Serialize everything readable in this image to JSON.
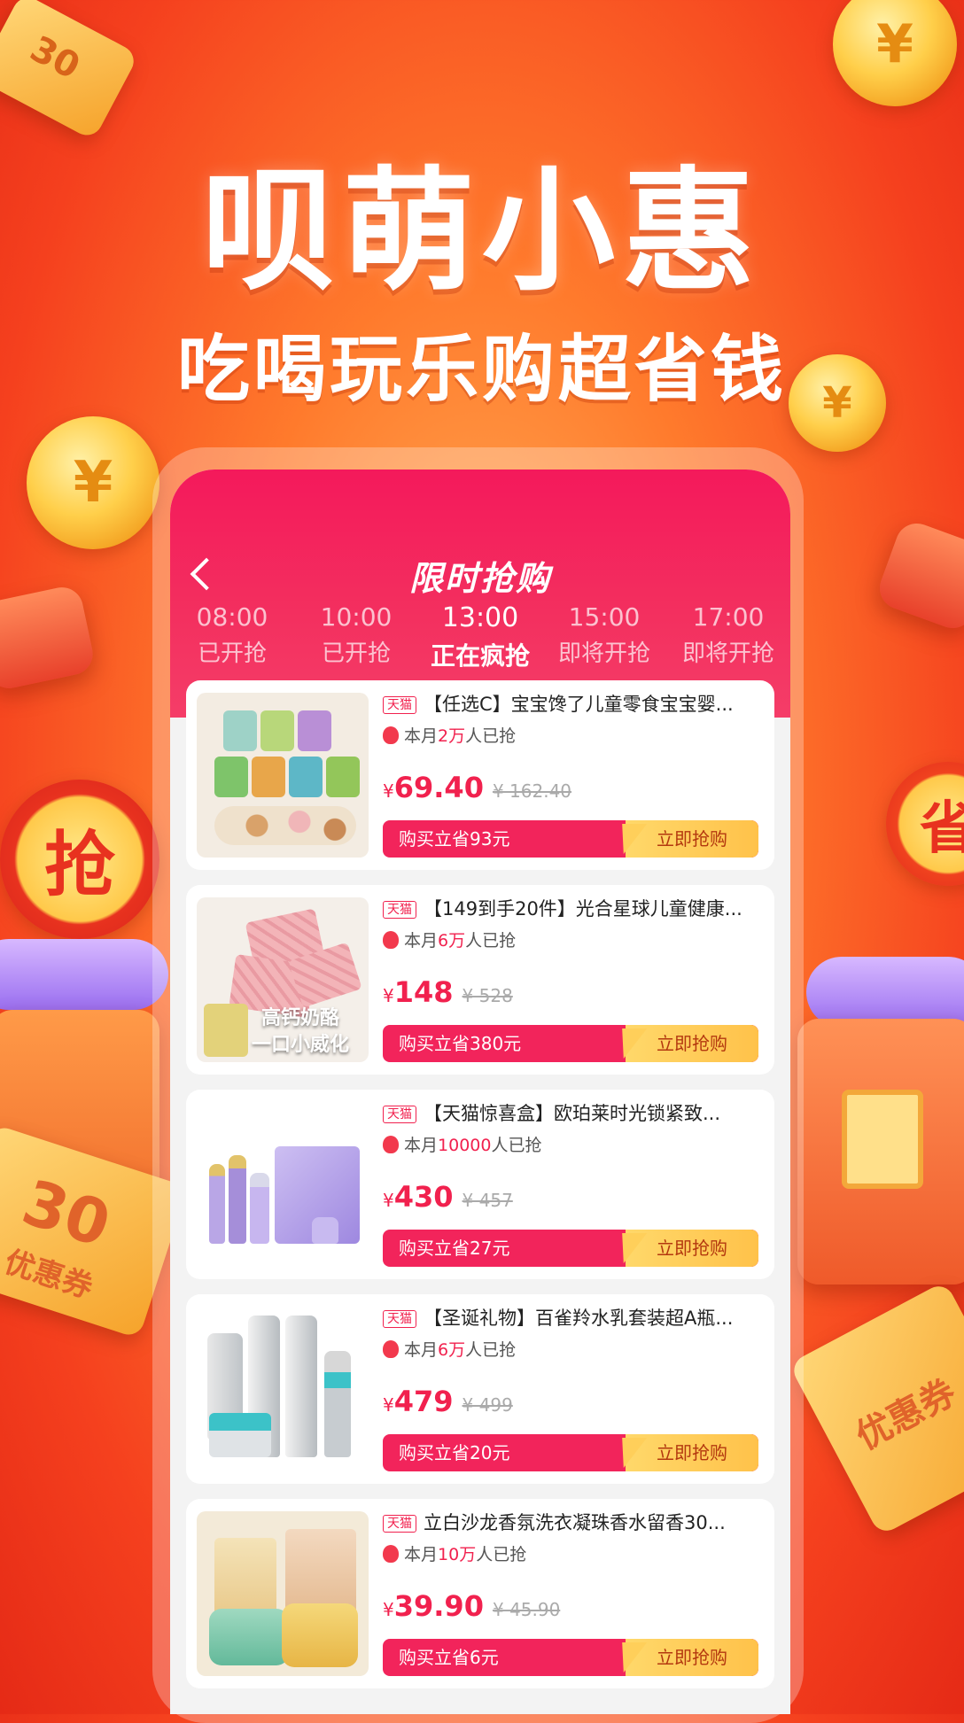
{
  "banner": {
    "title": "呗萌小惠",
    "subtitle": "吃喝玩乐购超省钱"
  },
  "decor": {
    "coupon_left": "30",
    "coupon_left_label": "优惠券",
    "coupon_right_label": "优惠券",
    "grab_badge": "抢",
    "save_badge": "省",
    "coin_symbol": "¥",
    "ticket_top_left": "30"
  },
  "screen": {
    "title": "限时抢购",
    "time_slots": [
      {
        "time": "08:00",
        "status": "已开抢"
      },
      {
        "time": "10:00",
        "status": "已开抢"
      },
      {
        "time": "13:00",
        "status": "正在疯抢"
      },
      {
        "time": "15:00",
        "status": "即将开抢"
      },
      {
        "time": "17:00",
        "status": "即将开抢"
      }
    ],
    "products": [
      {
        "tag": "天猫",
        "name": "【任选C】宝宝馋了儿童零食宝宝婴...",
        "sold_prefix": "本月",
        "sold_count": "2万",
        "sold_suffix": "人已抢",
        "currency": "¥",
        "price": "69.40",
        "original": "¥ 162.40",
        "save": "购买立省93元",
        "button": "立即抢购"
      },
      {
        "tag": "天猫",
        "name": "【149到手20件】光合星球儿童健康...",
        "sold_prefix": "本月",
        "sold_count": "6万",
        "sold_suffix": "人已抢",
        "currency": "¥",
        "price": "148",
        "original": "¥ 528",
        "save": "购买立省380元",
        "button": "立即抢购",
        "thumb_caption_1": "高钙奶酪",
        "thumb_caption_2": "一口小威化"
      },
      {
        "tag": "天猫",
        "name": "【天猫惊喜盒】欧珀莱时光锁紧致...",
        "sold_prefix": "本月",
        "sold_count": "10000",
        "sold_suffix": "人已抢",
        "currency": "¥",
        "price": "430",
        "original": "¥ 457",
        "save": "购买立省27元",
        "button": "立即抢购"
      },
      {
        "tag": "天猫",
        "name": "【圣诞礼物】百雀羚水乳套装超A瓶...",
        "sold_prefix": "本月",
        "sold_count": "6万",
        "sold_suffix": "人已抢",
        "currency": "¥",
        "price": "479",
        "original": "¥ 499",
        "save": "购买立省20元",
        "button": "立即抢购"
      },
      {
        "tag": "天猫",
        "name": "立白沙龙香氛洗衣凝珠香水留香30...",
        "sold_prefix": "本月",
        "sold_count": "10万",
        "sold_suffix": "人已抢",
        "currency": "¥",
        "price": "39.90",
        "original": "¥ 45.90",
        "save": "购买立省6元",
        "button": "立即抢购"
      }
    ]
  }
}
